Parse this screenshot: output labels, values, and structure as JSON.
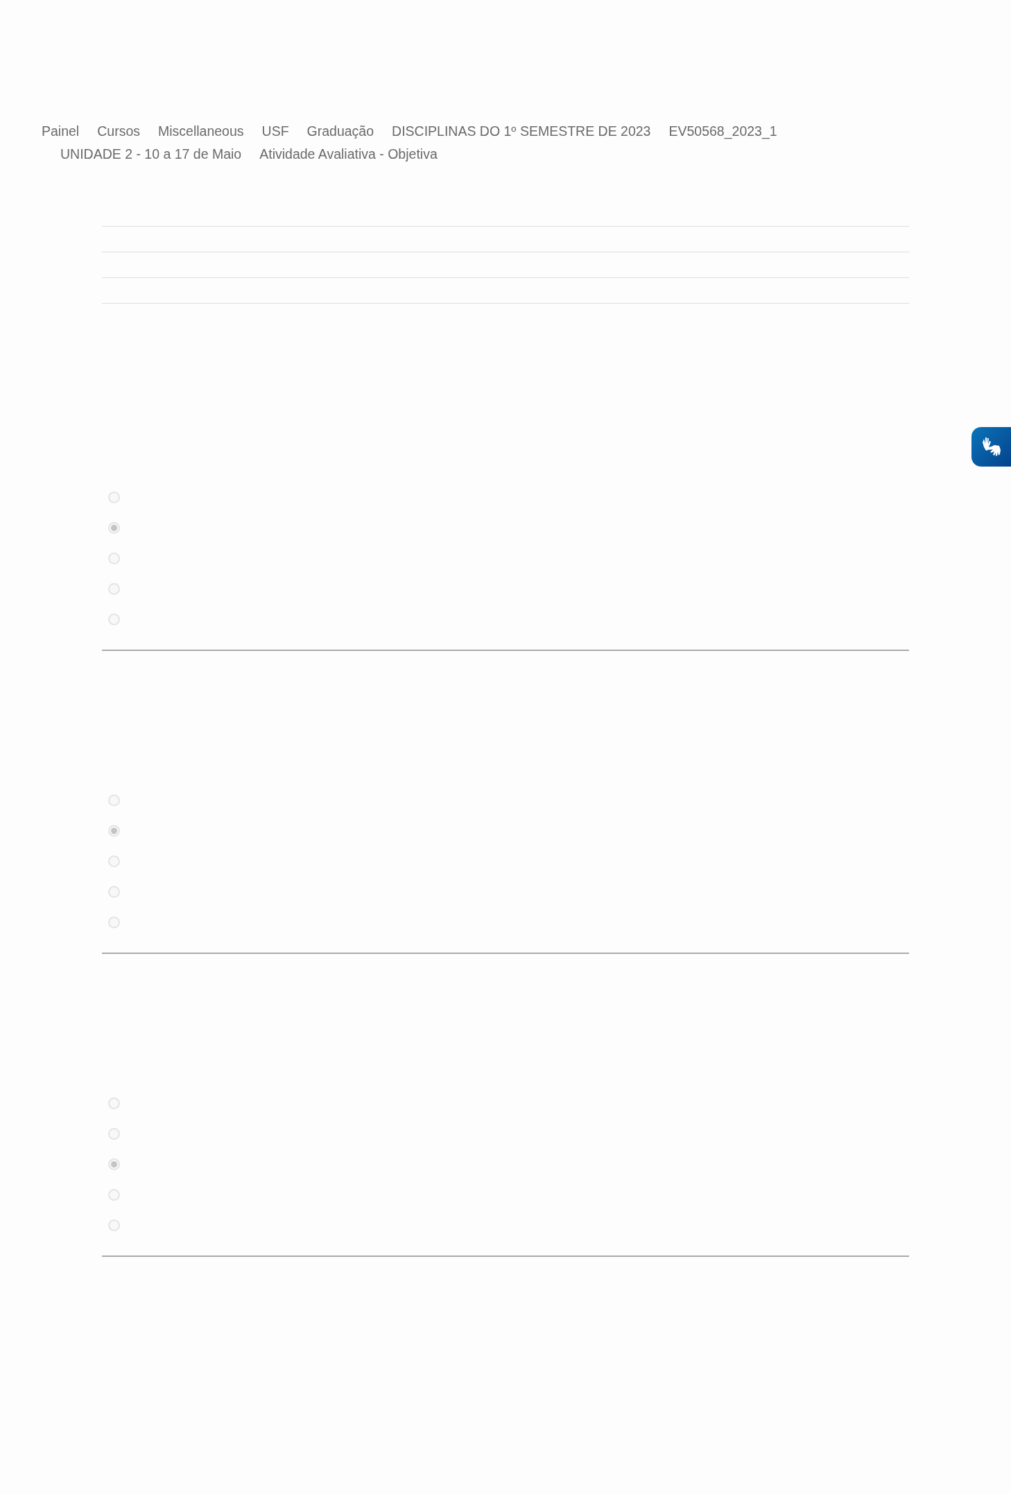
{
  "breadcrumb": [
    "Painel",
    "Cursos",
    "Miscellaneous",
    "USF",
    "Graduação",
    "DISCIPLINAS DO 1º SEMESTRE DE 2023",
    "EV50568_2023_1",
    "UNIDADE 2 - 10 a 17 de Maio",
    "Atividade Avaliativa - Objetiva"
  ],
  "questions": [
    {
      "options": [
        {
          "selected": false
        },
        {
          "selected": true
        },
        {
          "selected": false
        },
        {
          "selected": false
        },
        {
          "selected": false
        }
      ]
    },
    {
      "options": [
        {
          "selected": false
        },
        {
          "selected": true
        },
        {
          "selected": false
        },
        {
          "selected": false
        },
        {
          "selected": false
        }
      ]
    },
    {
      "options": [
        {
          "selected": false
        },
        {
          "selected": false
        },
        {
          "selected": true
        },
        {
          "selected": false
        },
        {
          "selected": false
        }
      ]
    }
  ]
}
